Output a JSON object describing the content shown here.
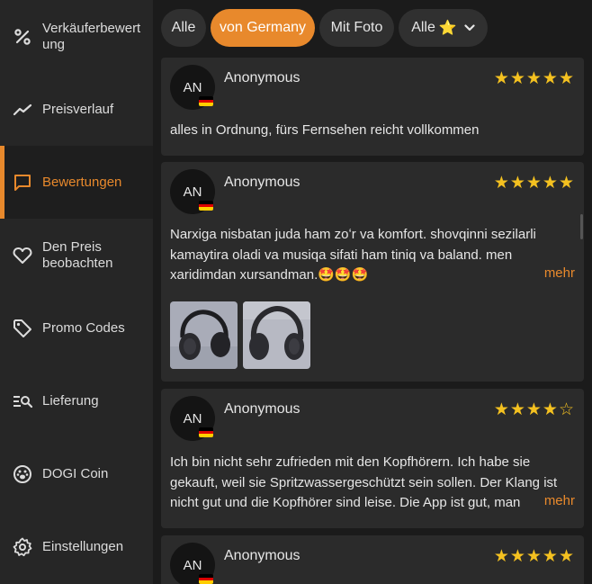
{
  "sidebar": {
    "items": [
      {
        "label": "Verkäuferbewertung",
        "icon": "percent-icon"
      },
      {
        "label": "Preisverlauf",
        "icon": "trend-line-icon"
      },
      {
        "label": "Bewertungen",
        "icon": "message-icon",
        "active": true
      },
      {
        "label": "Den Preis beobachten",
        "icon": "heart-icon"
      },
      {
        "label": "Promo Codes",
        "icon": "tag-icon"
      },
      {
        "label": "Lieferung",
        "icon": "list-search-icon"
      },
      {
        "label": "DOGI Coin",
        "icon": "paw-coin-icon"
      },
      {
        "label": "Einstellungen",
        "icon": "gear-icon"
      }
    ]
  },
  "filters": {
    "all": "Alle",
    "from_country": "von Germany",
    "with_photo": "Mit Foto",
    "rating": "Alle",
    "rating_star": "⭐"
  },
  "reviews": [
    {
      "initials": "AN",
      "author": "Anonymous",
      "rating": 5,
      "text": "alles in Ordnung, fürs Fernsehen reicht vollkommen"
    },
    {
      "initials": "AN",
      "author": "Anonymous",
      "rating": 5,
      "text": "Narxiga nisbatan juda ham zoʻr va komfort. shovqinni sezilarli kamaytira oladi va musiqa sifati ham tiniq va baland. men xaridimdan xursandman.🤩🤩🤩",
      "more": "mehr",
      "photos": [
        "headphones-photo-1",
        "headphones-photo-2"
      ]
    },
    {
      "initials": "AN",
      "author": "Anonymous",
      "rating": 4,
      "text": "Ich bin nicht sehr zufrieden mit den Kopfhörern. Ich habe sie gekauft, weil sie Spritzwassergeschützt sein sollen. Der Klang ist nicht gut und die Kopfhörer sind leise. Die App ist gut, man",
      "more": "mehr"
    },
    {
      "initials": "AN",
      "author": "Anonymous",
      "rating": 5
    }
  ],
  "colors": {
    "accent": "#e8892c",
    "star": "#f4c120",
    "sidebar_bg": "#262626",
    "card_bg": "#2b2b2b",
    "page_bg": "#1b1b1b"
  }
}
